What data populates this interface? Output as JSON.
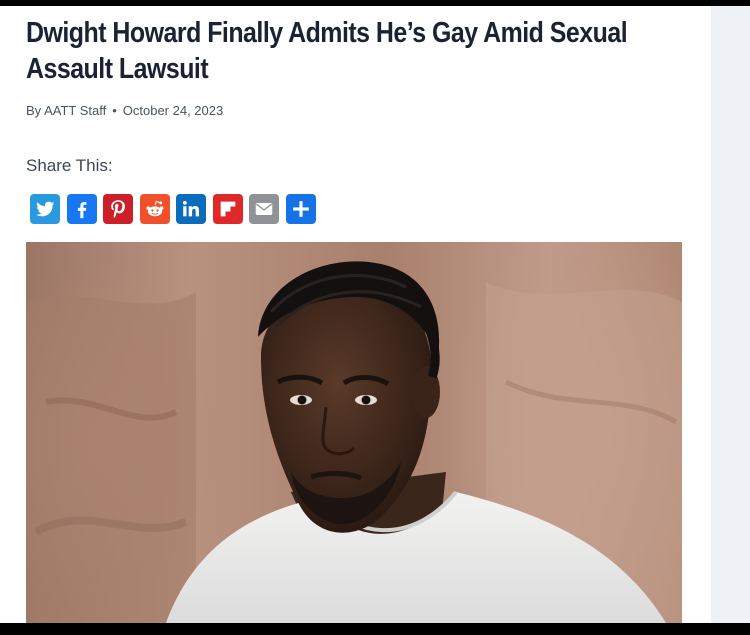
{
  "article": {
    "title": "Dwight Howard Finally Admits He’s Gay Amid Sexual Assault Lawsuit",
    "author": "By AATT Staff",
    "separator": "•",
    "date": "October 24, 2023",
    "share_label": "Share This:"
  },
  "share_buttons": [
    {
      "name": "twitter",
      "icon": "twitter-icon",
      "color": "#2a9ae0"
    },
    {
      "name": "facebook",
      "icon": "facebook-icon",
      "color": "#1877f2"
    },
    {
      "name": "pinterest",
      "icon": "pinterest-icon",
      "color": "#cc1f28"
    },
    {
      "name": "reddit",
      "icon": "reddit-icon",
      "color": "#f0502a"
    },
    {
      "name": "linkedin",
      "icon": "linkedin-icon",
      "color": "#0b6cbc"
    },
    {
      "name": "flipboard",
      "icon": "flipboard-icon",
      "color": "#e12828"
    },
    {
      "name": "email",
      "icon": "email-icon",
      "color": "#8f9297"
    },
    {
      "name": "share",
      "icon": "share-plus-icon",
      "color": "#1673e6"
    }
  ],
  "hero_image": {
    "subject": "portrait photo"
  }
}
